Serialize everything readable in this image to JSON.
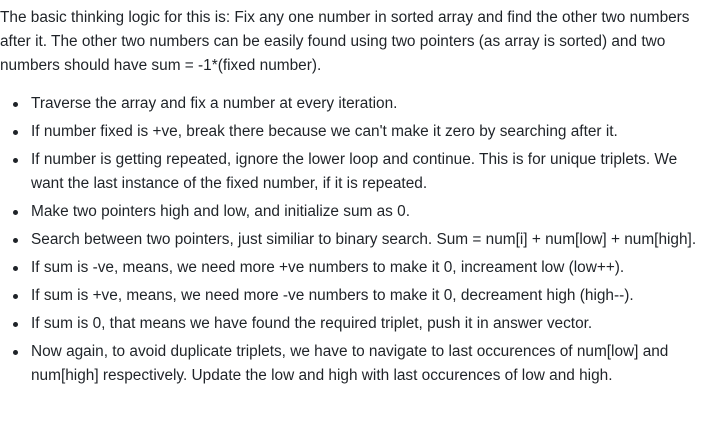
{
  "intro": "The basic thinking logic for this is: Fix any one number in sorted array and find the other two numbers after it. The other two numbers can be easily found using two pointers (as array is sorted) and two numbers should have sum = -1*(fixed number).",
  "points": [
    "Traverse the array and fix a number at every iteration.",
    "If number fixed is +ve, break there because we can't make it zero by searching after it.",
    "If number is getting repeated, ignore the lower loop and continue. This is for unique triplets. We want the last instance of the fixed number, if it is repeated.",
    "Make two pointers high and low, and initialize sum as 0.",
    "Search between two pointers, just similiar to binary search. Sum = num[i] + num[low] + num[high].",
    "If sum is -ve, means, we need more +ve numbers to make it 0, increament low (low++).",
    "If sum is +ve, means, we need more -ve numbers to make it 0, decreament high (high--).",
    "If sum is 0, that means we have found the required triplet, push it in answer vector.",
    "Now again, to avoid duplicate triplets, we have to navigate to last occurences of num[low] and num[high] respectively. Update the low and high with last occurences of low and high."
  ]
}
